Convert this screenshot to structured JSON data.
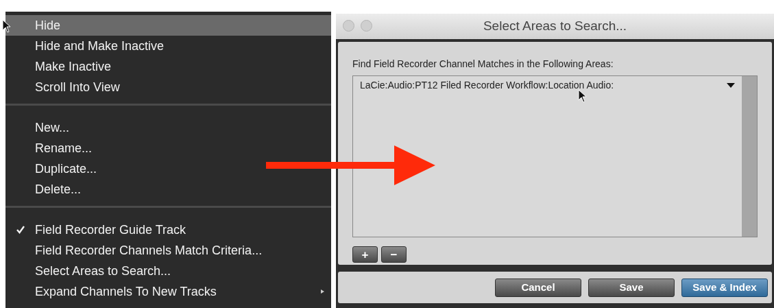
{
  "menu": {
    "sections": [
      {
        "items": [
          {
            "label": "Hide",
            "selected": true,
            "checked": false,
            "submenu": false
          },
          {
            "label": "Hide and Make Inactive",
            "selected": false,
            "checked": false,
            "submenu": false
          },
          {
            "label": "Make Inactive",
            "selected": false,
            "checked": false,
            "submenu": false
          },
          {
            "label": "Scroll Into View",
            "selected": false,
            "checked": false,
            "submenu": false
          }
        ]
      },
      {
        "items": [
          {
            "label": "New...",
            "selected": false,
            "checked": false,
            "submenu": false
          },
          {
            "label": "Rename...",
            "selected": false,
            "checked": false,
            "submenu": false
          },
          {
            "label": "Duplicate...",
            "selected": false,
            "checked": false,
            "submenu": false
          },
          {
            "label": "Delete...",
            "selected": false,
            "checked": false,
            "submenu": false
          }
        ]
      },
      {
        "items": [
          {
            "label": "Field Recorder Guide Track",
            "selected": false,
            "checked": true,
            "submenu": false
          },
          {
            "label": "Field Recorder Channels Match Criteria...",
            "selected": false,
            "checked": false,
            "submenu": false
          },
          {
            "label": "Select Areas to Search...",
            "selected": false,
            "checked": false,
            "submenu": false
          },
          {
            "label": "Expand Channels To New Tracks",
            "selected": false,
            "checked": false,
            "submenu": true
          }
        ]
      }
    ]
  },
  "dialog": {
    "title": "Select Areas to Search...",
    "prompt": "Find Field Recorder Channel Matches in the Following Areas:",
    "areas": [
      {
        "path": "LaCie:Audio:PT12 Filed Recorder Workflow:Location Audio:"
      }
    ],
    "list_buttons": [
      "+",
      "−"
    ],
    "buttons": [
      {
        "label": "Cancel",
        "kind": "normal"
      },
      {
        "label": "Save",
        "kind": "normal"
      },
      {
        "label": "Save & Index",
        "kind": "default"
      }
    ]
  }
}
